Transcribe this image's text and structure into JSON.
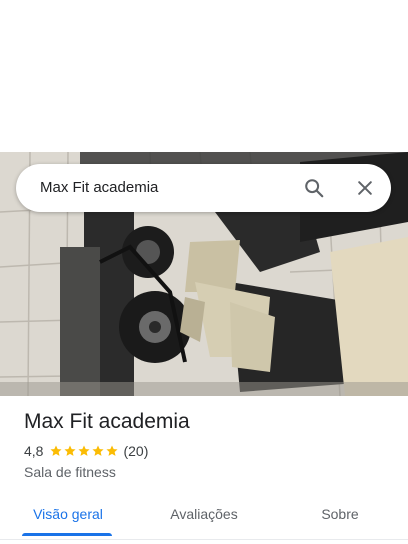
{
  "search": {
    "value": "Max Fit academia",
    "search_icon": "search-icon",
    "close_icon": "close-icon"
  },
  "place": {
    "name": "Max Fit academia",
    "rating": "4,8",
    "stars": 5,
    "review_count": "(20)",
    "category": "Sala de fitness"
  },
  "tabs": [
    {
      "label": "Visão geral",
      "active": true
    },
    {
      "label": "Avaliações",
      "active": false
    },
    {
      "label": "Sobre",
      "active": false
    }
  ],
  "colors": {
    "accent": "#1a73e8",
    "star": "#fbbc04",
    "text": "#202124",
    "secondary": "#5f6368"
  }
}
